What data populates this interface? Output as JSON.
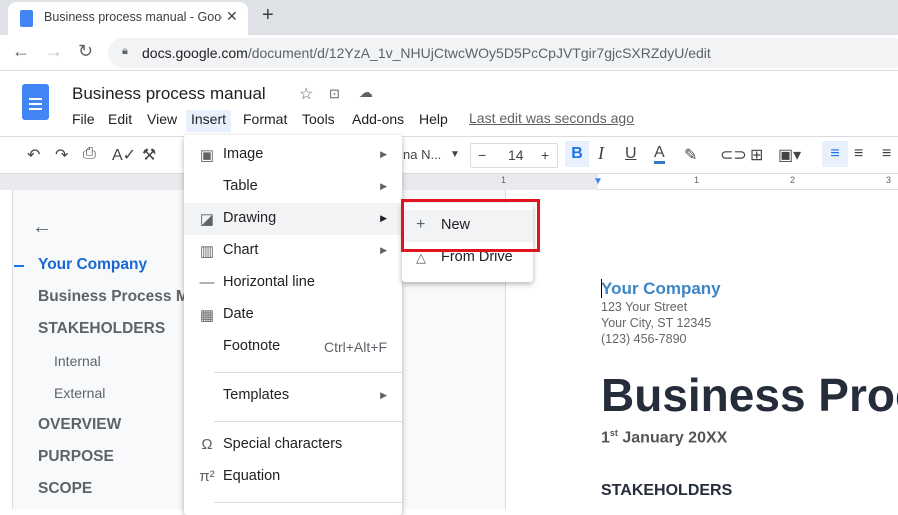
{
  "browser": {
    "tab_title": "Business process manual - Google Docs",
    "tab_title_visible": "Business process manual - Goog",
    "url_host": "docs.google.com",
    "url_path": "/document/d/12YzA_1v_NHUjCtwcWOy5D5PcCpJVTgir7gjcSXRZdyU/edit"
  },
  "doc": {
    "title": "Business process manual",
    "menus": [
      "File",
      "Edit",
      "View",
      "Insert",
      "Format",
      "Tools",
      "Add-ons",
      "Help"
    ],
    "last_edit": "Last edit was seconds ago"
  },
  "toolbar": {
    "font": "na N...",
    "font_size": "14",
    "accent": "#1a73e8"
  },
  "ruler": [
    "1",
    "1",
    "2",
    "3"
  ],
  "outline": {
    "items": [
      "Your Company",
      "Business Process M",
      "STAKEHOLDERS",
      "Internal",
      "External",
      "OVERVIEW",
      "PURPOSE",
      "SCOPE"
    ]
  },
  "insert_menu": {
    "items": [
      {
        "label": "Image",
        "icon": "image-icon",
        "submenu": true
      },
      {
        "label": "Table",
        "submenu": true
      },
      {
        "label": "Drawing",
        "icon": "drawing-icon",
        "submenu": true
      },
      {
        "label": "Chart",
        "icon": "chart-icon",
        "submenu": true
      },
      {
        "label": "Horizontal line",
        "icon": "horizontal-line-icon"
      },
      {
        "label": "Date",
        "icon": "calendar-icon"
      },
      {
        "label": "Footnote",
        "shortcut": "Ctrl+Alt+F"
      },
      {
        "label": "Templates",
        "submenu": true
      },
      {
        "label": "Special characters",
        "icon": "omega-icon"
      },
      {
        "label": "Equation",
        "icon": "pi-icon"
      }
    ]
  },
  "drawing_submenu": {
    "items": [
      {
        "label": "New",
        "icon": "plus-icon"
      },
      {
        "label": "From Drive",
        "icon": "drive-icon"
      }
    ],
    "highlight_color": "#e0141e"
  },
  "page": {
    "company": "Your Company",
    "street": "123 Your Street",
    "city": "Your City, ST 12345",
    "phone": "(123) 456-7890",
    "title": "Business Proc",
    "date_num": "1",
    "date_sup": "st",
    "date_rest": " January 20XX",
    "heading": "STAKEHOLDERS"
  }
}
